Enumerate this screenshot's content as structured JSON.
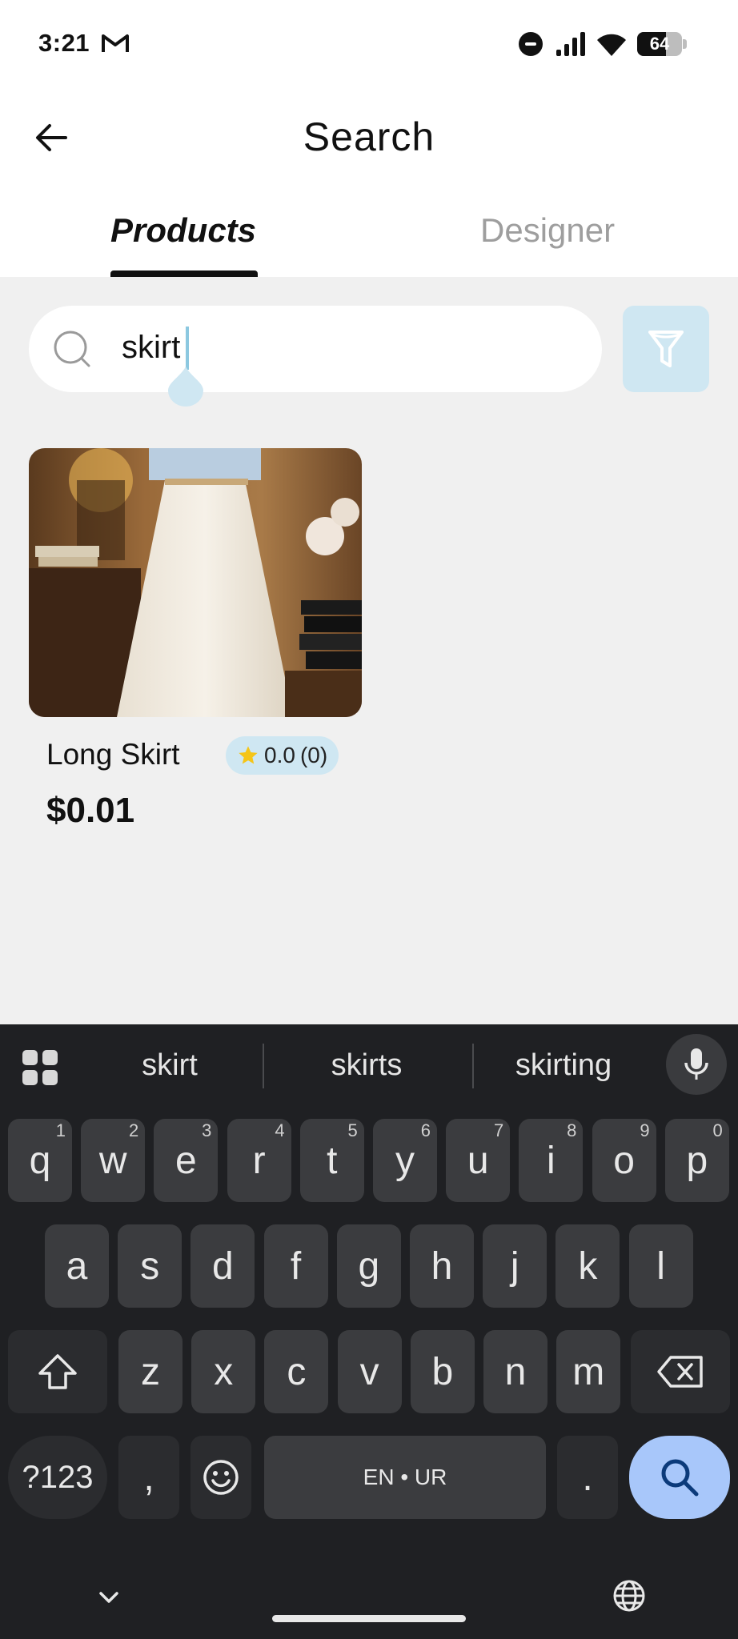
{
  "status_bar": {
    "time": "3:21",
    "battery": "64",
    "battery_level_pct": 64
  },
  "header": {
    "title": "Search"
  },
  "tabs": [
    {
      "label": "Products",
      "active": true
    },
    {
      "label": "Designer",
      "active": false
    }
  ],
  "search": {
    "value": "skirt"
  },
  "products": [
    {
      "name": "Long Skirt",
      "rating": "0.0",
      "reviews": "(0)",
      "price": "$0.01"
    }
  ],
  "keyboard": {
    "suggestions": [
      "skirt",
      "skirts",
      "skirting"
    ],
    "row1": [
      {
        "k": "q",
        "h": "1"
      },
      {
        "k": "w",
        "h": "2"
      },
      {
        "k": "e",
        "h": "3"
      },
      {
        "k": "r",
        "h": "4"
      },
      {
        "k": "t",
        "h": "5"
      },
      {
        "k": "y",
        "h": "6"
      },
      {
        "k": "u",
        "h": "7"
      },
      {
        "k": "i",
        "h": "8"
      },
      {
        "k": "o",
        "h": "9"
      },
      {
        "k": "p",
        "h": "0"
      }
    ],
    "row2": [
      "a",
      "s",
      "d",
      "f",
      "g",
      "h",
      "j",
      "k",
      "l"
    ],
    "row3": [
      "z",
      "x",
      "c",
      "v",
      "b",
      "n",
      "m"
    ],
    "symbols_label": "?123",
    "comma": ",",
    "space_label": "EN • UR",
    "period": "."
  },
  "colors": {
    "accent_light_blue": "#cfe7f2",
    "search_key": "#a8c7fa",
    "keyboard_bg": "#1f2023"
  }
}
